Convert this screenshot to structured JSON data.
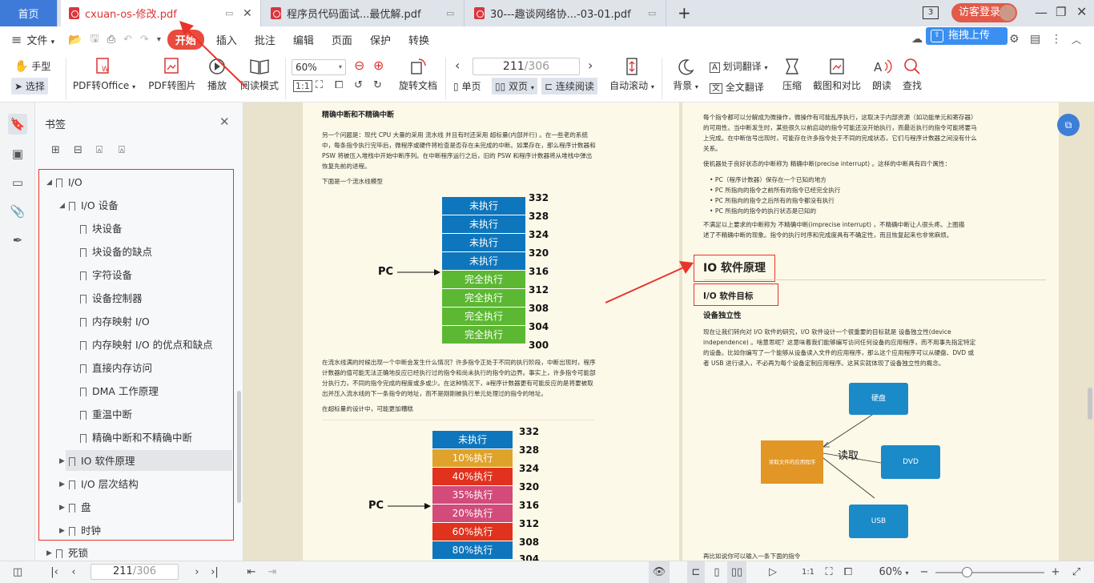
{
  "tabs": {
    "home": "首页",
    "tab1": "cxuan-os-修改.pdf",
    "tab2": "程序员代码面试...最优解.pdf",
    "tab3": "30---趣谈网络协...-03-01.pdf",
    "add": "+",
    "count": "3",
    "login": "访客登录"
  },
  "menu": {
    "file": "文件",
    "items": [
      "开始",
      "插入",
      "批注",
      "编辑",
      "页面",
      "保护",
      "转换"
    ],
    "upload": "拖拽上传"
  },
  "ribbon": {
    "hand": "手型",
    "select": "选择",
    "pdf_office": "PDF转Office",
    "pdf_image": "PDF转图片",
    "play": "播放",
    "read_mode": "阅读模式",
    "zoom": "60%",
    "page_input": "211",
    "page_total": "/306",
    "rotate": "旋转文档",
    "single": "单页",
    "double": "双页",
    "continuous": "连续阅读",
    "auto_scroll": "自动滚动",
    "background": "背景",
    "word_translate": "划词翻译",
    "full_translate": "全文翻译",
    "compress": "压缩",
    "compare": "截图和对比",
    "read_aloud": "朗读",
    "find": "查找"
  },
  "panel": {
    "title": "书签",
    "items": [
      {
        "label": "I/O"
      },
      {
        "label": "I/O 设备"
      },
      {
        "label": "块设备"
      },
      {
        "label": "块设备的缺点"
      },
      {
        "label": "字符设备"
      },
      {
        "label": "设备控制器"
      },
      {
        "label": "内存映射 I/O"
      },
      {
        "label": "内存映射 I/O 的优点和缺点"
      },
      {
        "label": "直接内存访问"
      },
      {
        "label": "DMA 工作原理"
      },
      {
        "label": "重温中断"
      },
      {
        "label": "精确中断和不精确中断"
      },
      {
        "label": "IO 软件原理"
      },
      {
        "label": "I/O 层次结构"
      },
      {
        "label": "盘"
      },
      {
        "label": "时钟"
      },
      {
        "label": "死锁"
      }
    ]
  },
  "left_page": {
    "heading": "精确中断和不精确中断",
    "para1": [
      "另一个问题是：现代 CPU 大量的采用 流水线 并且有时还采用 超标量(内部并行) 。在一些老的系统",
      "中，每条指令执行完毕后，微程序或硬件将检查是否存在未完成的中断。如果存在，那么程序计数器和",
      "PSW 将被压入堆栈中开始中断序列。在中断程序运行之后，旧的 PSW 和程序计数器将从堆栈中弹出",
      "恢复先前的进程。"
    ],
    "caption1": "下面是一个流水线模型",
    "pipeline1": {
      "rows": [
        "未执行",
        "未执行",
        "未执行",
        "未执行",
        "完全执行",
        "完全执行",
        "完全执行",
        "完全执行"
      ],
      "nums": [
        "332",
        "328",
        "324",
        "320",
        "316",
        "312",
        "308",
        "304",
        "300"
      ],
      "pc": "PC"
    },
    "para2": [
      "在流水线满的时候出现一个中断会发生什么情况？许多指令正处于不同的执行阶段，中断出现时，程序",
      "计数器的值可能无法正确地反应已经执行过的指令和尚未执行的指令的边界。事实上，许多指令可能部",
      "分执行力，不同的指令完成的程度或多或少。在这种情况下，a程序计数器更有可能反应的是将要被取",
      "出并压入流水线的下一条指令的地址，而不是刚刚被执行单元处理过的指令的地址。"
    ],
    "caption2": "在超标量的设计中，可能更加糟糕",
    "pipeline2": {
      "rows": [
        "未执行",
        "10%执行",
        "40%执行",
        "35%执行",
        "20%执行",
        "60%执行",
        "80%执行"
      ],
      "nums": [
        "332",
        "328",
        "324",
        "320",
        "316",
        "312",
        "308",
        "304"
      ],
      "pc": "PC"
    }
  },
  "right_page": {
    "para1": [
      "每个指令都可以分解成为微操作，微操作有可能乱序执行，这取决于内部资源（如功能单元和寄存器）",
      "的可用性。当中断发生时，某些很久以前启动的指令可能还没开始执行，而最近执行的指令可能将要马",
      "上完成。在中断信号出现时，可能存在许多指令处于不同的完成状态，它们与程序计数器之间没有什么",
      "关系。"
    ],
    "para2": "使机器处于良好状态的中断称为 精确中断(precise interrupt) 。这样的中断具有四个属性：",
    "bullets": [
      "PC（程序计数器）保存在一个已知的地方",
      "PC 所指向的指令之前所有的指令已经完全执行",
      "PC 所指向的指令之后所有的指令都没有执行",
      "PC 所指向的指令的执行状态是已知的"
    ],
    "para3": [
      "不满足以上要求的中断称为 不精确中断(imprecise interrupt) ，不精确中断让人很头疼。上图描",
      "述了不精确中断的现象。指令的执行时序和完成度具有不确定性，而且恢复起来也非常麻烦。"
    ],
    "h1": "IO 软件原理",
    "h2": "I/O 软件目标",
    "h3": "设备独立性",
    "para4": [
      "现在让我们转向对 I/O 软件的研究，I/O 软件设计一个很重要的目标就是 设备独立性(device",
      "independence) 。啥意思呢？这意味着我们能够编写访问任何设备的应用程序，而不用事先指定特定",
      "的设备。比如你编写了一个能够从设备读入文件的应用程序，那么这个应用程序可以从硬盘、DVD 或",
      "者 USB 进行读入，不必再为每个设备定制应用程序。这其实就体现了设备独立性的概念。"
    ],
    "diagram": {
      "app": "读取文件的应用程序",
      "read": "读取",
      "disk": "硬盘",
      "dvd": "DVD",
      "usb": "USB"
    },
    "tail": "再比如说你可以输入一条下面的指令"
  },
  "status": {
    "page_input": "211",
    "page_total": "/306",
    "zoom": "60%"
  },
  "colors": {
    "accent": "#e94b3c",
    "tab_home": "#3e7bd9",
    "blue": "#0e76bd",
    "green": "#5cb832",
    "gold": "#dfa22a",
    "red": "#e0321d",
    "pink": "#d24b7a",
    "annotation": "#e8332b"
  }
}
